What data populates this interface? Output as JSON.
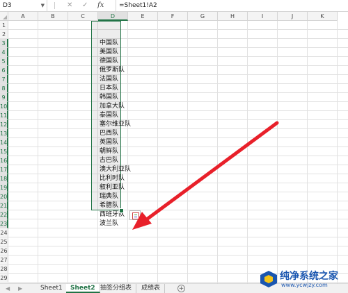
{
  "formula_bar": {
    "name_box": "D3",
    "fx_label": "fx",
    "formula": "=Sheet1!A2"
  },
  "columns": [
    "A",
    "B",
    "C",
    "D",
    "E",
    "F",
    "G",
    "H",
    "I",
    "J",
    "K"
  ],
  "selected_column": "D",
  "rows": [
    "1",
    "2",
    "3",
    "4",
    "5",
    "6",
    "7",
    "8",
    "9",
    "10",
    "11",
    "12",
    "13",
    "14",
    "15",
    "16",
    "17",
    "18",
    "19",
    "20",
    "21",
    "22",
    "23",
    "24",
    "25",
    "26",
    "27",
    "28",
    "29"
  ],
  "selected_rows_range": [
    "3",
    "23"
  ],
  "column_d_values": [
    "中国队",
    "美国队",
    "德国队",
    "俄罗斯队",
    "法国队",
    "日本队",
    "韩国队",
    "加拿大队",
    "泰国队",
    "塞尔维亚队",
    "巴西队",
    "英国队",
    "朝鲜队",
    "古巴队",
    "澳大利亚队",
    "比利时队",
    "叙利亚队",
    "瑞典队",
    "希腊队",
    "西班牙队",
    "波兰队"
  ],
  "sheet_tabs": [
    "Sheet1",
    "Sheet2",
    "抽签分组表",
    "成绩表"
  ],
  "active_sheet": "Sheet2",
  "watermark": {
    "title": "纯净系统之家",
    "url": "www.ycwjzy.com"
  },
  "colors": {
    "accent": "#217346",
    "arrow": "#e8202a",
    "watermark": "#1a56b0"
  }
}
